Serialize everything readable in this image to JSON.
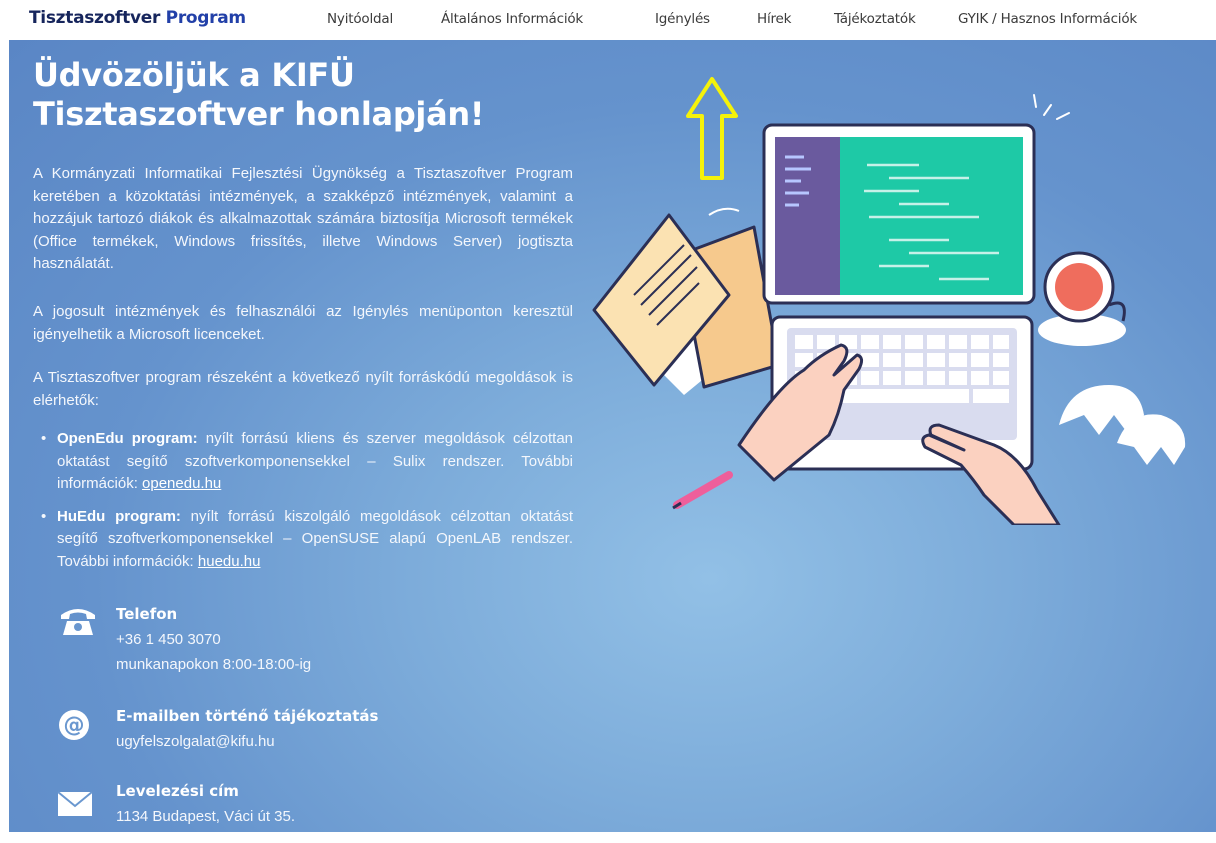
{
  "header": {
    "brand_part1": "Tisztaszoftver",
    "brand_part2": "Program",
    "nav": [
      {
        "label": "Nyitóoldal"
      },
      {
        "label": "Általános Információk"
      },
      {
        "label": "Igénylés"
      },
      {
        "label": "Hírek"
      },
      {
        "label": "Tájékoztatók"
      },
      {
        "label": "GYIK / Hasznos Információk"
      }
    ]
  },
  "hero": {
    "title_line1": "Üdvözöljük a KIFÜ",
    "title_line2": "Tisztaszoftver honlapján!",
    "paragraphs": [
      "A Kormányzati Informatikai Fejlesztési Ügynökség a Tisztaszoftver Program keretében a közoktatási intézmények, a szakképző intézmények, valamint a hozzájuk tartozó diákok és alkalmazottak számára biztosítja Microsoft termékek (Office termékek, Windows frissítés, illetve Windows Server) jogtiszta használatát.",
      "A jogosult intézmények és felhasználói az Igénylés menüponton keresztül igényelhetik a Microsoft licenceket.",
      "A Tisztaszoftver program részeként a következő nyílt forráskódú megoldások is elérhetők:"
    ],
    "bullets": [
      {
        "bold": "OpenEdu program:",
        "text": " nyílt forrású kliens és szerver megoldások célzottan oktatást segítő szoftverkomponensekkel – Sulix rendszer. További információk: ",
        "link": "openedu.hu"
      },
      {
        "bold": "HuEdu program:",
        "text": " nyílt forrású kiszolgáló megoldások célzottan oktatást segítő szoftverkomponensekkel – OpenSUSE alapú OpenLAB rendszer. További információk: ",
        "link": "huedu.hu"
      }
    ]
  },
  "contacts": {
    "phone": {
      "title": "Telefon",
      "number": "+36 1 450 3070",
      "hours": "munkanapokon 8:00-18:00-ig",
      "icon": "telephone-icon"
    },
    "email": {
      "title": "E-mailben történő tájékoztatás",
      "address": "ugyfelszolgalat@kifu.hu",
      "icon": "at-sign-icon"
    },
    "mail": {
      "title": "Levelezési cím",
      "address": "1134 Budapest, Váci út 35.",
      "icon": "envelope-icon"
    }
  },
  "colors": {
    "brand_dark": "#16255c",
    "brand_blue": "#2240a8",
    "hero_blue": "#6593cd",
    "highlight_arrow": "#f5f20a",
    "screen_teal": "#1ec9a6"
  }
}
